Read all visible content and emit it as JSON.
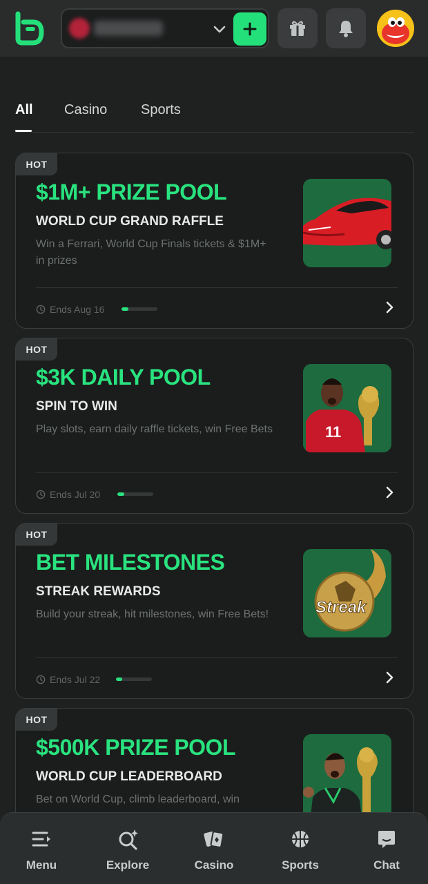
{
  "header": {
    "wallet_amount": "",
    "add_label": "+"
  },
  "tabs": [
    {
      "label": "All",
      "active": true
    },
    {
      "label": "Casino",
      "active": false
    },
    {
      "label": "Sports",
      "active": false
    }
  ],
  "promos": [
    {
      "badge": "HOT",
      "title": "$1M+ PRIZE POOL",
      "subtitle": "WORLD CUP GRAND RAFFLE",
      "description": "Win a Ferrari, World Cup Finals tickets & $1M+ in prizes",
      "ends": "Ends Aug 16",
      "progress": 0.2,
      "image": "red-sports-car"
    },
    {
      "badge": "HOT",
      "title": "$3K DAILY POOL",
      "subtitle": "SPIN TO WIN",
      "description": "Play slots, earn daily raffle tickets, win Free Bets",
      "ends": "Ends Jul 20",
      "progress": 0.2,
      "image": "footballer-and-trophy"
    },
    {
      "badge": "HOT",
      "title": "BET MILESTONES",
      "subtitle": "STREAK REWARDS",
      "description": "Build your streak, hit milestones, win Free Bets!",
      "ends": "Ends Jul 22",
      "progress": 0.18,
      "image": "streak-ball"
    },
    {
      "badge": "HOT",
      "title": "$500K PRIZE POOL",
      "subtitle": "WORLD CUP LEADERBOARD",
      "description": "Bet on World Cup, climb leaderboard, win",
      "image": "celebrating-player-and-trophy"
    }
  ],
  "bottom_nav": [
    {
      "label": "Menu",
      "icon": "menu-icon"
    },
    {
      "label": "Explore",
      "icon": "explore-icon"
    },
    {
      "label": "Casino",
      "icon": "cards-icon"
    },
    {
      "label": "Sports",
      "icon": "basketball-icon"
    },
    {
      "label": "Chat",
      "icon": "chat-icon"
    }
  ],
  "colors": {
    "accent": "#29e37f",
    "background": "#1f2120",
    "card": "#1b1d1c",
    "header": "#2a2c2c"
  }
}
